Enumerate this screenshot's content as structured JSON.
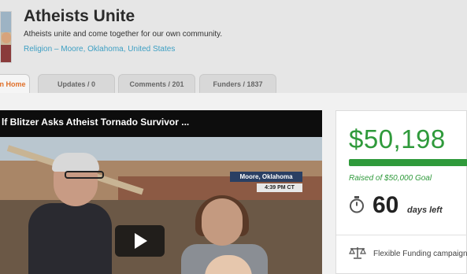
{
  "campaign": {
    "title": "Atheists Unite",
    "subtitle": "Atheists unite and come together for our own community.",
    "location": "Religion – Moore, Oklahoma, United States"
  },
  "tabs": [
    {
      "label": "n Home",
      "active": true
    },
    {
      "label": "Updates / 0",
      "active": false
    },
    {
      "label": "Comments / 201",
      "active": false
    },
    {
      "label": "Funders / 1837",
      "active": false
    }
  ],
  "video": {
    "title": "lf Blitzer Asks Atheist Tornado Survivor ...",
    "location_badge": "Moore, Oklahoma",
    "time_badge": "4:39 PM CT"
  },
  "funding": {
    "amount": "$50,198",
    "goal_text": "Raised of $50,000 Goal",
    "progress": 1.0,
    "days_number": "60",
    "days_label": "days left",
    "funding_type": "Flexible Funding campaign"
  },
  "colors": {
    "accent_green": "#2f9a3b",
    "link_blue": "#3d9fc3",
    "active_tab_orange": "#e0702a"
  },
  "icons": [
    "stopwatch-icon",
    "scale-icon",
    "play-icon"
  ]
}
